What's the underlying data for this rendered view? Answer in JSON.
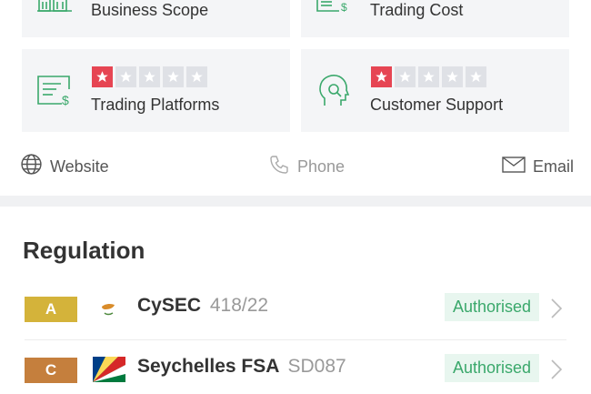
{
  "cards": {
    "business_scope": {
      "label": "Business Scope",
      "icon": "building-icon"
    },
    "trading_cost": {
      "label": "Trading Cost",
      "icon": "price-doc-icon"
    },
    "trading_platforms": {
      "label": "Trading Platforms",
      "icon": "price-doc-icon",
      "rating": 1,
      "max_rating": 5
    },
    "customer_support": {
      "label": "Customer Support",
      "icon": "headset-head-icon",
      "rating": 1,
      "max_rating": 5
    }
  },
  "contacts": {
    "website": "Website",
    "phone": "Phone",
    "email": "Email"
  },
  "regulation": {
    "title": "Regulation",
    "rows": [
      {
        "grade": "A",
        "grade_color": "#d4b33a",
        "flag": "cyprus-flag",
        "name": "CySEC",
        "license": "418/22",
        "status": "Authorised"
      },
      {
        "grade": "C",
        "grade_color": "#c57f3d",
        "flag": "seychelles-flag",
        "name": "Seychelles FSA",
        "license": "SD087",
        "status": "Authorised"
      }
    ]
  },
  "colors": {
    "accent_green": "#3aa86b",
    "star_red": "#e64553"
  }
}
